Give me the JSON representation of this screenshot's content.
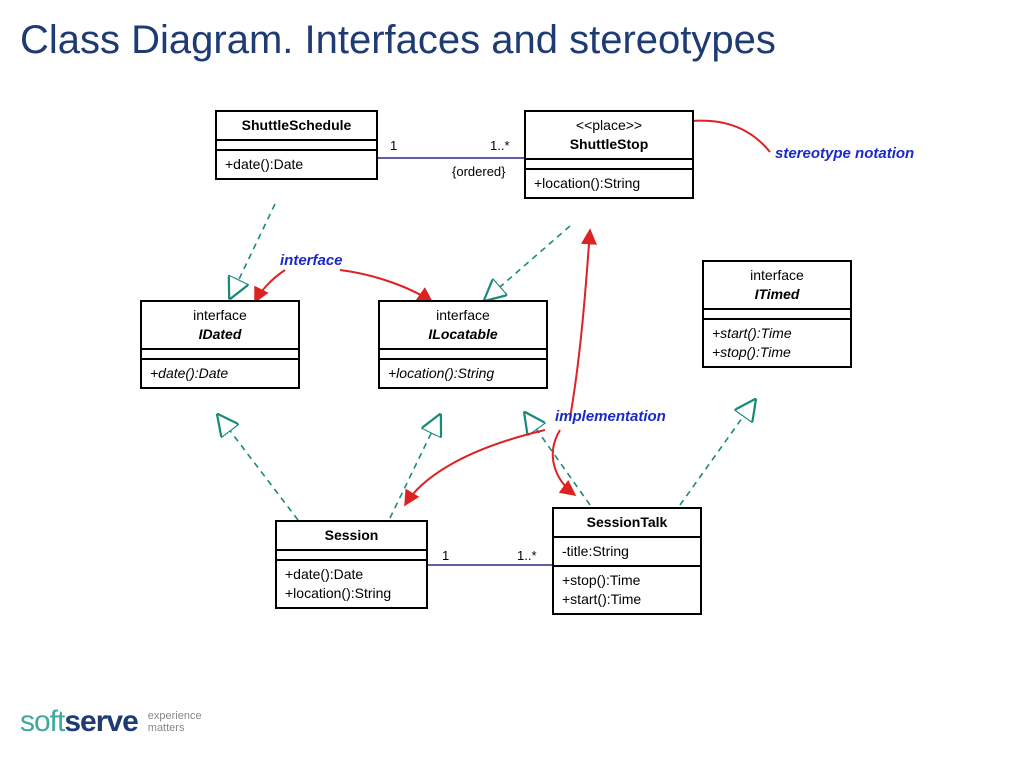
{
  "title": "Class Diagram. Interfaces and stereotypes",
  "notes": {
    "stereotype": "stereotype notation",
    "interface": "interface",
    "implementation": "implementation"
  },
  "assoc1": {
    "left_mult": "1",
    "right_mult": "1..*",
    "constraint": "{ordered}"
  },
  "assoc2": {
    "left_mult": "1",
    "right_mult": "1..*"
  },
  "boxes": {
    "shuttleSchedule": {
      "name": "ShuttleSchedule",
      "op1": "+date():Date"
    },
    "shuttleStop": {
      "stereo": "<<place>>",
      "name": "ShuttleStop",
      "op1": "+location():String"
    },
    "idated": {
      "stereo": "interface",
      "name": "IDated",
      "op1": "+date():Date"
    },
    "ilocatable": {
      "stereo": "interface",
      "name": "ILocatable",
      "op1": "+location():String"
    },
    "itimed": {
      "stereo": "interface",
      "name": "ITimed",
      "op1": "+start():Time",
      "op2": "+stop():Time"
    },
    "session": {
      "name": "Session",
      "op1": "+date():Date",
      "op2": "+location():String"
    },
    "sessionTalk": {
      "name": "SessionTalk",
      "attr1": "-title:String",
      "op1": "+stop():Time",
      "op2": "+start():Time"
    }
  },
  "logo": {
    "part1": "soft",
    "part2": "serve",
    "tag1": "experience",
    "tag2": "matters"
  }
}
